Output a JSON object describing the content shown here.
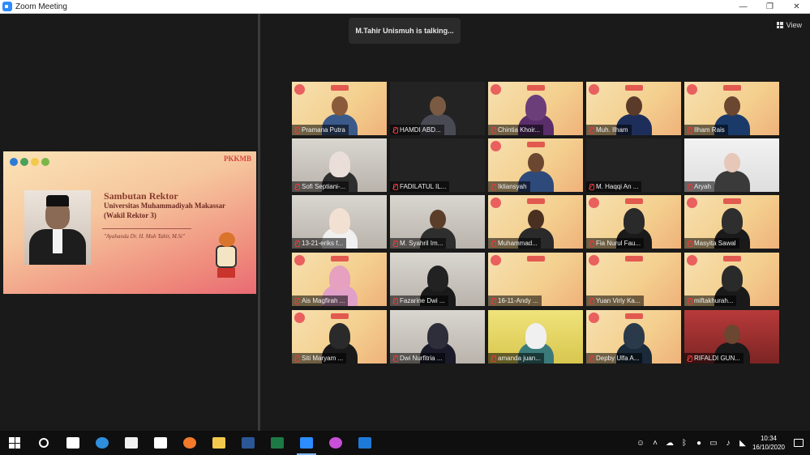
{
  "window": {
    "title": "Zoom Meeting",
    "minimize": "—",
    "restore": "❐",
    "close": "✕"
  },
  "meeting": {
    "active_speaker": "M.Tahir Unismuh is talking...",
    "view_label": "View"
  },
  "shared_screen": {
    "heading": "Sambutan Rektor",
    "subtitle_line1": "Universitas Muhammadiyah Makassar",
    "subtitle_line2": "(Wakil Rektor 3)",
    "quote": "\"Ayahanda Dr. H. Muh Tahir, M.Si\"",
    "brand": "PKKMB"
  },
  "participants": [
    {
      "name": "Pramana Putra",
      "bg": "banner",
      "skin": "#8a5a3a",
      "cloth": "#3a5a8a",
      "hijab": false
    },
    {
      "name": "HAMDI ABD...",
      "bg": "dark",
      "skin": "#7a5a42",
      "cloth": "#4a4a55",
      "hijab": false
    },
    {
      "name": "Chintia Khoir...",
      "bg": "banner",
      "skin": "#6b3e7a",
      "cloth": "#5a2e6a",
      "hijab": true
    },
    {
      "name": "Muh. Ilham",
      "bg": "banner",
      "skin": "#5a3a28",
      "cloth": "#1e2e5a",
      "hijab": false
    },
    {
      "name": "Ilham Rais",
      "bg": "banner",
      "skin": "#6b4630",
      "cloth": "#1a3a6a",
      "hijab": false
    },
    {
      "name": "Sofi Septiani-...",
      "bg": "room",
      "skin": "#e9dfd8",
      "cloth": "#2e2e2e",
      "hijab": true
    },
    {
      "name": "FADILATUL IL...",
      "bg": "dark",
      "skin": "",
      "cloth": "",
      "hijab": false
    },
    {
      "name": "Ikliansyah",
      "bg": "banner",
      "skin": "#6b4630",
      "cloth": "#2e4a7a",
      "hijab": false
    },
    {
      "name": "M. Haqqi An ...",
      "bg": "dark",
      "skin": "",
      "cloth": "",
      "hijab": false
    },
    {
      "name": "Aryah",
      "bg": "white",
      "skin": "#e6c7b8",
      "cloth": "#3a3a3a",
      "hijab": false
    },
    {
      "name": "13-21-eriks f...",
      "bg": "room",
      "skin": "#f2e0d2",
      "cloth": "#f0f0f0",
      "hijab": true
    },
    {
      "name": "M. Syahril Im...",
      "bg": "room",
      "skin": "#5a3e2a",
      "cloth": "#2e2e2e",
      "hijab": false
    },
    {
      "name": "Muhammad...",
      "bg": "banner",
      "skin": "#4a3020",
      "cloth": "#2a2a2a",
      "hijab": false
    },
    {
      "name": "Fia Nurul Fau...",
      "bg": "banner",
      "skin": "#2a2a2a",
      "cloth": "#1a1a1a",
      "hijab": true
    },
    {
      "name": "Masyita Sawal",
      "bg": "banner",
      "skin": "#2e2e2e",
      "cloth": "#1a1a1a",
      "hijab": true
    },
    {
      "name": "Ais Magfirah ...",
      "bg": "banner",
      "skin": "#e6a0c0",
      "cloth": "#e0a0c8",
      "hijab": true
    },
    {
      "name": "Fazarine Dwi ...",
      "bg": "room",
      "skin": "#222222",
      "cloth": "#1a1a1a",
      "hijab": true
    },
    {
      "name": "16-11-Andy ...",
      "bg": "banner",
      "skin": "",
      "cloth": "",
      "hijab": false
    },
    {
      "name": "Yuan Virly Ka...",
      "bg": "banner",
      "skin": "",
      "cloth": "",
      "hijab": false
    },
    {
      "name": "miftakhurah...",
      "bg": "banner",
      "skin": "#2a2a2a",
      "cloth": "#1a1a1a",
      "hijab": true
    },
    {
      "name": "Siti Maryam ...",
      "bg": "banner",
      "skin": "#2a2a2a",
      "cloth": "#1a1a1a",
      "hijab": true
    },
    {
      "name": "Dwi Nurfitria ...",
      "bg": "room",
      "skin": "#2e2e3a",
      "cloth": "#1a1a2a",
      "hijab": true
    },
    {
      "name": "amanda juan...",
      "bg": "yellowroom",
      "skin": "#f0f0f0",
      "cloth": "#3a7a7a",
      "hijab": true
    },
    {
      "name": "Depby Ulfa A...",
      "bg": "banner",
      "skin": "#2a3a4a",
      "cloth": "#1a2a3a",
      "hijab": true
    },
    {
      "name": "RIFALDI GUN...",
      "bg": "redroom",
      "skin": "#6b4630",
      "cloth": "#1a1a1a",
      "hijab": false
    }
  ],
  "taskbar": {
    "apps": [
      {
        "name": "start",
        "color": "#ffffff"
      },
      {
        "name": "search",
        "color": "#ffffff"
      },
      {
        "name": "task-view",
        "color": "#ffffff"
      },
      {
        "name": "edge",
        "color": "#2f8fdc"
      },
      {
        "name": "store",
        "color": "#f0f0f0"
      },
      {
        "name": "mail",
        "color": "#ffffff"
      },
      {
        "name": "firefox",
        "color": "#f27a2a"
      },
      {
        "name": "file-explorer",
        "color": "#f2c94c"
      },
      {
        "name": "word",
        "color": "#2b5797"
      },
      {
        "name": "excel",
        "color": "#1e7a45"
      },
      {
        "name": "zoom",
        "color": "#2d8cff"
      },
      {
        "name": "maps",
        "color": "#c84fd8"
      },
      {
        "name": "bluetooth",
        "color": "#1e7ad8"
      }
    ],
    "time": "10:34",
    "date": "16/10/2020"
  }
}
